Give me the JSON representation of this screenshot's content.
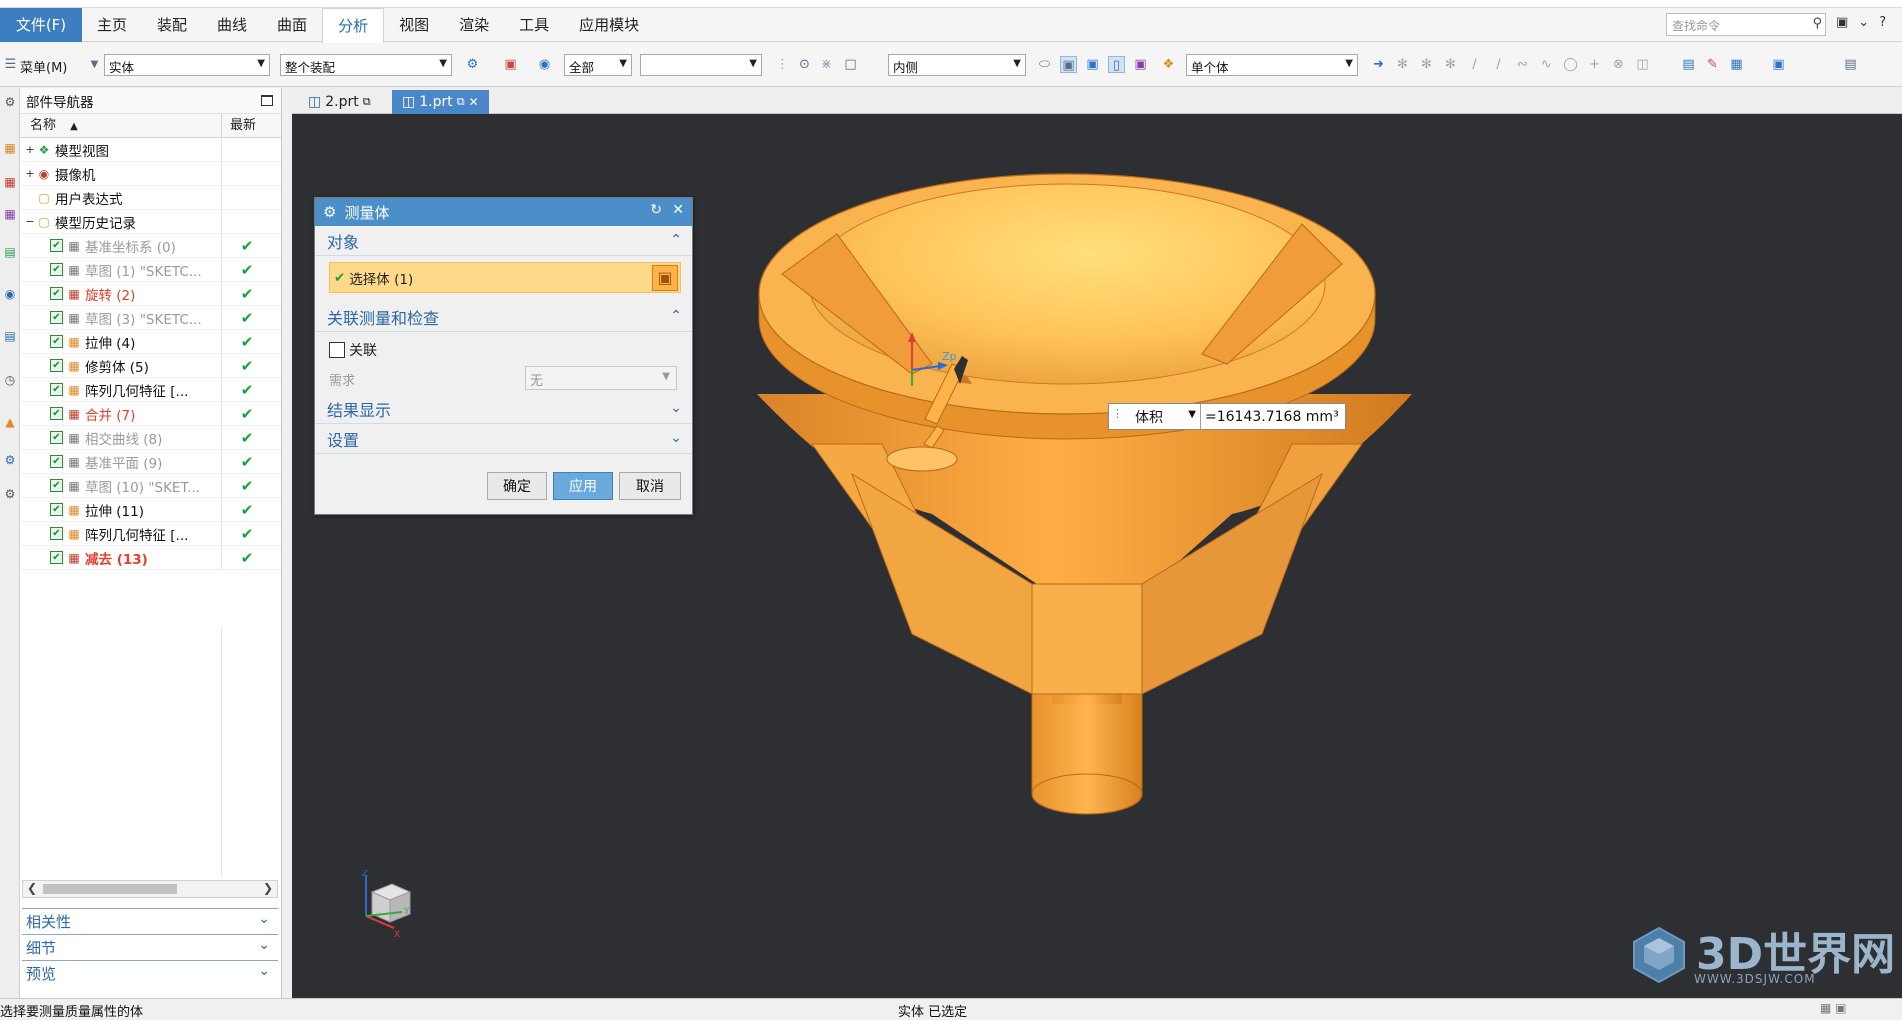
{
  "menubar": {
    "file": "文件(F)",
    "items": [
      "主页",
      "装配",
      "曲线",
      "曲面",
      "分析",
      "视图",
      "渲染",
      "工具",
      "应用模块"
    ],
    "active_index": 4,
    "search_placeholder": "查找命令"
  },
  "toolbar": {
    "menu_label": "菜单(M)",
    "filter_type": "实体",
    "filter_scope": "整个装配",
    "filter_all": "全部",
    "filter_blank": "",
    "filter_inside": "内侧",
    "filter_body": "单个体"
  },
  "navigator": {
    "title": "部件导航器",
    "col_name": "名称",
    "col_latest": "最新",
    "rows": [
      {
        "label": "模型视图",
        "style": "black",
        "expand": "+",
        "check": false,
        "latest": false
      },
      {
        "label": "摄像机",
        "style": "black",
        "expand": "+",
        "check": false,
        "latest": false
      },
      {
        "label": "用户表达式",
        "style": "black",
        "expand": "",
        "check": false,
        "latest": false
      },
      {
        "label": "模型历史记录",
        "style": "black",
        "expand": "−",
        "check": false,
        "latest": false
      },
      {
        "label": "基准坐标系 (0)",
        "style": "gray",
        "expand": "",
        "check": true,
        "latest": true
      },
      {
        "label": "草图 (1) \"SKETC...",
        "style": "gray",
        "expand": "",
        "check": true,
        "latest": true
      },
      {
        "label": "旋转 (2)",
        "style": "red",
        "expand": "",
        "check": true,
        "latest": true
      },
      {
        "label": "草图 (3) \"SKETC...",
        "style": "gray",
        "expand": "",
        "check": true,
        "latest": true
      },
      {
        "label": "拉伸 (4)",
        "style": "black",
        "expand": "",
        "check": true,
        "latest": true
      },
      {
        "label": "修剪体 (5)",
        "style": "black",
        "expand": "",
        "check": true,
        "latest": true
      },
      {
        "label": "阵列几何特征 [...",
        "style": "black",
        "expand": "",
        "check": true,
        "latest": true
      },
      {
        "label": "合并 (7)",
        "style": "red",
        "expand": "",
        "check": true,
        "latest": true
      },
      {
        "label": "相交曲线 (8)",
        "style": "gray",
        "expand": "",
        "check": true,
        "latest": true
      },
      {
        "label": "基准平面 (9)",
        "style": "gray",
        "expand": "",
        "check": true,
        "latest": true
      },
      {
        "label": "草图 (10) \"SKET...",
        "style": "gray",
        "expand": "",
        "check": true,
        "latest": true
      },
      {
        "label": "拉伸 (11)",
        "style": "black",
        "expand": "",
        "check": true,
        "latest": true
      },
      {
        "label": "阵列几何特征 [...",
        "style": "black",
        "expand": "",
        "check": true,
        "latest": true
      },
      {
        "label": "减去 (13)",
        "style": "red",
        "expand": "",
        "check": true,
        "latest": true
      }
    ],
    "panels": [
      "相关性",
      "细节",
      "预览"
    ]
  },
  "doctabs": [
    {
      "label": "2.prt",
      "active": false
    },
    {
      "label": "1.prt",
      "active": true
    }
  ],
  "dialog": {
    "title": "测量体",
    "section_object": "对象",
    "select_body": "选择体 (1)",
    "section_assoc": "关联测量和检查",
    "assoc_label": "关联",
    "need_label": "需求",
    "need_value": "无",
    "section_result": "结果显示",
    "section_settings": "设置",
    "ok": "确定",
    "apply": "应用",
    "cancel": "取消"
  },
  "callout": {
    "quantity": "体积",
    "value": "=16143.7168 mm³"
  },
  "triad": {
    "x": "X",
    "y": "Y",
    "z": "Z",
    "zp": "Zp"
  },
  "statusbar": {
    "left": "选择要测量质量属性的体",
    "mid": "实体 已选定"
  },
  "watermark": {
    "text": "3D世界网",
    "sub": "WWW.3DSJW.COM"
  },
  "colors": {
    "accent": "#4b8ec8",
    "model": "#f2a640",
    "viewport": "#2e2f33"
  }
}
